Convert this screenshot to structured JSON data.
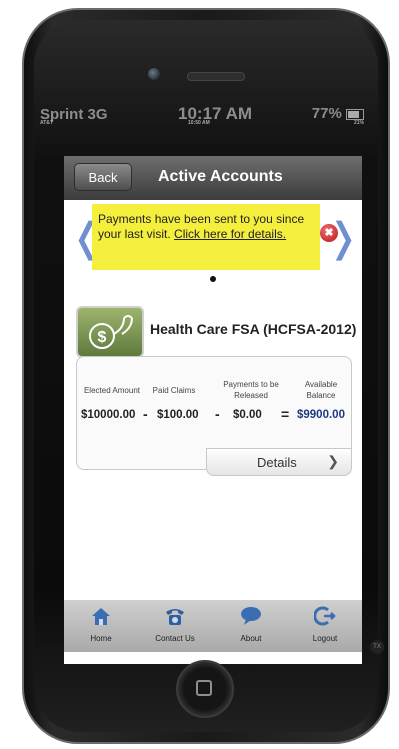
{
  "status_bar": {
    "carrier": "Sprint 3G",
    "time": "10:17 AM",
    "battery": "77%",
    "time_small": "10:50 AM",
    "carrier_small": "AT&T",
    "battery_small": "21%"
  },
  "nav": {
    "back_label": "Back",
    "title": "Active Accounts"
  },
  "notice": {
    "text": "Payments have been sent to you since your last visit.",
    "link": "Click here for details."
  },
  "account": {
    "title": "Health Care FSA (HCFSA-2012)",
    "headers": {
      "elected": "Elected Amount",
      "paid": "Paid Claims",
      "released": "Payments to be Released",
      "available": "Available Balance"
    },
    "values": {
      "elected": "$10000.00",
      "paid": "$100.00",
      "released": "$0.00",
      "available": "$9900.00"
    },
    "operators": [
      "-",
      "-",
      "="
    ],
    "details_label": "Details"
  },
  "tabs": [
    {
      "label": "Home",
      "icon": "home-icon"
    },
    {
      "label": "Contact Us",
      "icon": "phone-icon"
    },
    {
      "label": "About",
      "icon": "chat-bubble-icon"
    },
    {
      "label": "Logout",
      "icon": "logout-icon"
    }
  ],
  "colors": {
    "notice_bg": "#f4ee3d",
    "arrow": "#6f8fd0",
    "available_value": "#203880",
    "close_button": "#c41a1a"
  },
  "misc": {
    "corner_badge": "TX"
  }
}
